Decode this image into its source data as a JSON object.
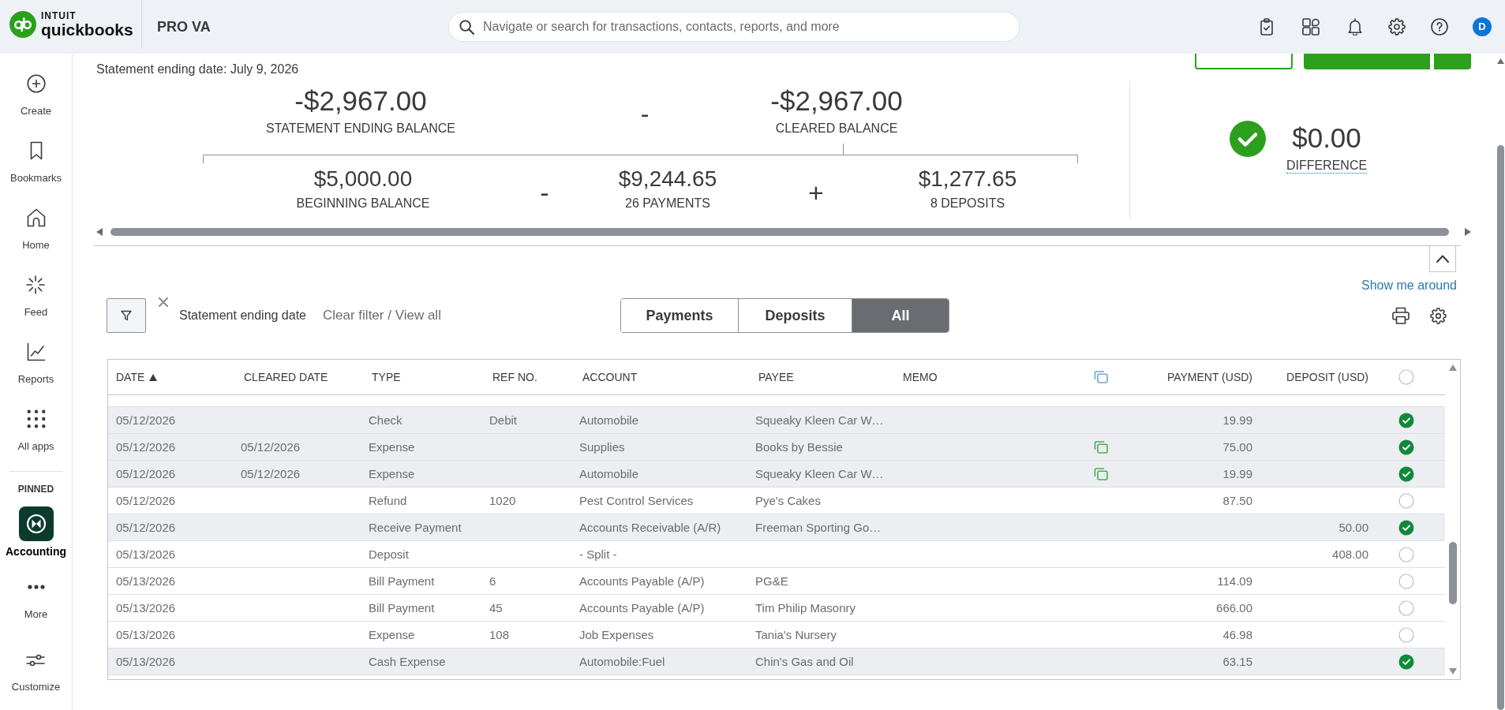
{
  "top_bar": {
    "logo": {
      "maker": "INTUIT",
      "product": "quickbooks"
    },
    "company": "PRO VA",
    "search": {
      "placeholder": "Navigate or search for transactions, contacts, reports, and more"
    },
    "avatar": "D"
  },
  "sidebar": {
    "items": [
      {
        "label": "Create",
        "selected": false
      },
      {
        "label": "Bookmarks",
        "selected": false
      },
      {
        "label": "Home",
        "selected": false
      },
      {
        "label": "Feed",
        "selected": false
      },
      {
        "label": "Reports",
        "selected": false
      },
      {
        "label": "All apps",
        "selected": false
      }
    ],
    "pinned": {
      "heading": "PINNED",
      "items": [
        {
          "label": "Accounting",
          "selected": true
        }
      ]
    },
    "more_items": [
      {
        "label": "More",
        "selected": false
      },
      {
        "label": "Customize",
        "selected": false
      }
    ]
  },
  "statement_ending_date": "Statement ending date: July 9, 2026",
  "summary": {
    "top_row": [
      {
        "kind": "figure",
        "amount": "-$2,967.00",
        "label": "STATEMENT ENDING BALANCE"
      },
      {
        "kind": "operator",
        "symbol": "-"
      },
      {
        "kind": "figure",
        "amount": "-$2,967.00",
        "label": "CLEARED BALANCE"
      }
    ],
    "bottom_row": [
      {
        "kind": "figure",
        "amount": "$5,000.00",
        "label": "BEGINNING BALANCE"
      },
      {
        "kind": "operator",
        "symbol": "-"
      },
      {
        "kind": "figure",
        "amount": "$9,244.65",
        "label": "26 PAYMENTS"
      },
      {
        "kind": "operator",
        "symbol": "+"
      },
      {
        "kind": "figure",
        "amount": "$1,277.65",
        "label": "8 DEPOSITS"
      }
    ],
    "difference": {
      "balanced": true,
      "amount": "$0.00",
      "label": "DIFFERENCE"
    }
  },
  "help_link": "Show me around",
  "filter_bar": {
    "active_filter": "Statement ending date",
    "clear_filter": "Clear filter / View all",
    "tabs": [
      {
        "label": "Payments",
        "selected": false
      },
      {
        "label": "Deposits",
        "selected": false
      },
      {
        "label": "All",
        "selected": true
      }
    ]
  },
  "table": {
    "columns": [
      {
        "label": "DATE",
        "sorted": true
      },
      {
        "label": "CLEARED DATE",
        "sorted": false
      },
      {
        "label": "TYPE",
        "sorted": false
      },
      {
        "label": "REF NO.",
        "sorted": false
      },
      {
        "label": "ACCOUNT",
        "sorted": false
      },
      {
        "label": "PAYEE",
        "sorted": false
      },
      {
        "label": "MEMO",
        "sorted": false
      },
      {
        "label": "PAYMENT (USD)",
        "sorted": false
      },
      {
        "label": "DEPOSIT (USD)",
        "sorted": false
      }
    ],
    "select_all": {
      "checked": false
    },
    "rows": [
      {
        "date": "05/12/2026",
        "type": "Check",
        "ref_no": "Debit",
        "account": "Automobile",
        "payee": "Squeaky Kleen Car W…",
        "payment": "19.99",
        "linked": false,
        "cleared": true
      },
      {
        "date": "05/12/2026",
        "cleared_date": "05/12/2026",
        "type": "Expense",
        "account": "Supplies",
        "payee": "Books by Bessie",
        "payment": "75.00",
        "linked": true,
        "cleared": true
      },
      {
        "date": "05/12/2026",
        "cleared_date": "05/12/2026",
        "type": "Expense",
        "account": "Automobile",
        "payee": "Squeaky Kleen Car W…",
        "payment": "19.99",
        "linked": true,
        "cleared": true
      },
      {
        "date": "05/12/2026",
        "type": "Refund",
        "ref_no": "1020",
        "account": "Pest Control Services",
        "payee": "Pye's Cakes",
        "payment": "87.50",
        "linked": false,
        "cleared": false
      },
      {
        "date": "05/12/2026",
        "type": "Receive Payment",
        "account": "Accounts Receivable (A/R)",
        "payee": "Freeman Sporting Go…",
        "deposit": "50.00",
        "linked": false,
        "cleared": true
      },
      {
        "date": "05/13/2026",
        "type": "Deposit",
        "account": "- Split -",
        "deposit": "408.00",
        "linked": false,
        "cleared": false
      },
      {
        "date": "05/13/2026",
        "type": "Bill Payment",
        "ref_no": "6",
        "account": "Accounts Payable (A/P)",
        "payee": "PG&E",
        "payment": "114.09",
        "linked": false,
        "cleared": false
      },
      {
        "date": "05/13/2026",
        "type": "Bill Payment",
        "ref_no": "45",
        "account": "Accounts Payable (A/P)",
        "payee": "Tim Philip Masonry",
        "payment": "666.00",
        "linked": false,
        "cleared": false
      },
      {
        "date": "05/13/2026",
        "type": "Expense",
        "ref_no": "108",
        "account": "Job Expenses",
        "payee": "Tania's Nursery",
        "payment": "46.98",
        "linked": false,
        "cleared": false
      },
      {
        "date": "05/13/2026",
        "type": "Cash Expense",
        "account": "Automobile:Fuel",
        "payee": "Chin's Gas and Oil",
        "payment": "63.15",
        "linked": false,
        "cleared": true
      }
    ]
  }
}
